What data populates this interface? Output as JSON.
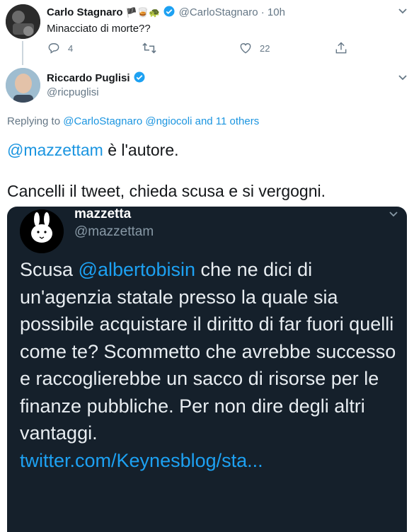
{
  "parent_tweet": {
    "author_name": "Carlo Stagnaro",
    "author_emojis": "🏴🥃🐢",
    "handle": "@CarloStagnaro",
    "separator": "·",
    "time": "10h",
    "text": "Minacciato di morte??",
    "reply_count": "4",
    "like_count": "22"
  },
  "main_tweet": {
    "author_name": "Riccardo Puglisi",
    "handle": "@ricpuglisi",
    "replying_prefix": "Replying to",
    "replying_handles": "@CarloStagnaro @ngiocoli",
    "replying_suffix": "and 11 others",
    "mention": "@mazzettam",
    "line1_rest": " è l'autore.",
    "line2": "Cancelli il tweet, chieda scusa e si vergogni."
  },
  "embedded_screenshot": {
    "author_name": "mazzetta",
    "handle": "@mazzettam",
    "text_prefix": "Scusa ",
    "mention": "@albertobisin",
    "text_body": " che ne dici di un'agenzia statale presso la quale sia possibile acquistare il diritto di far fuori quelli come te? Scommetto che avrebbe successo e raccoglierebbe un sacco di risorse per le finanze pubbliche. Per non dire degli altri vantaggi.",
    "link": "twitter.com/Keynesblog/sta..."
  },
  "colors": {
    "link": "#1b95e0",
    "verified": "#1da1f2",
    "dark_bg": "#15202b",
    "muted": "#657786"
  }
}
